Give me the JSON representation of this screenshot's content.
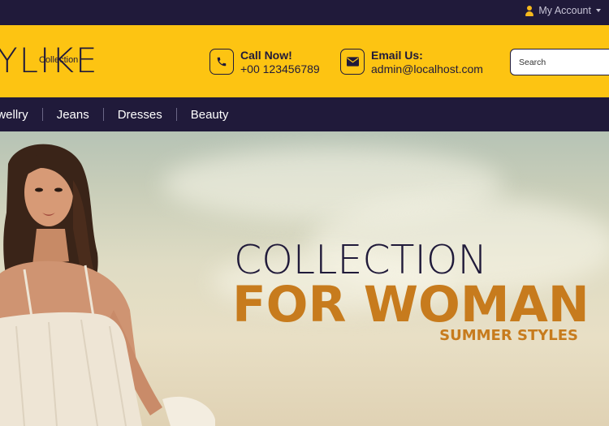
{
  "topbar": {
    "account_label": "My Account",
    "account_icon": "user-icon",
    "accent_color": "#f6b91c"
  },
  "header": {
    "logo_main": "YLIKE",
    "logo_sub": "Collection",
    "phone": {
      "title": "Call Now!",
      "value": "+00 123456789",
      "icon": "phone-icon"
    },
    "email": {
      "title": "Email Us:",
      "value": "admin@localhost.com",
      "icon": "envelope-icon"
    },
    "search_placeholder": "Search",
    "background_color": "#fdc412"
  },
  "nav": {
    "items": [
      "ewellry",
      "Jeans",
      "Dresses",
      "Beauty"
    ],
    "background_color": "#201a3a"
  },
  "hero": {
    "line1": "COLLECTION",
    "line2": "FOR WOMAN",
    "line3": "SUMMER STYLES",
    "accent_color": "#c77b1d"
  }
}
